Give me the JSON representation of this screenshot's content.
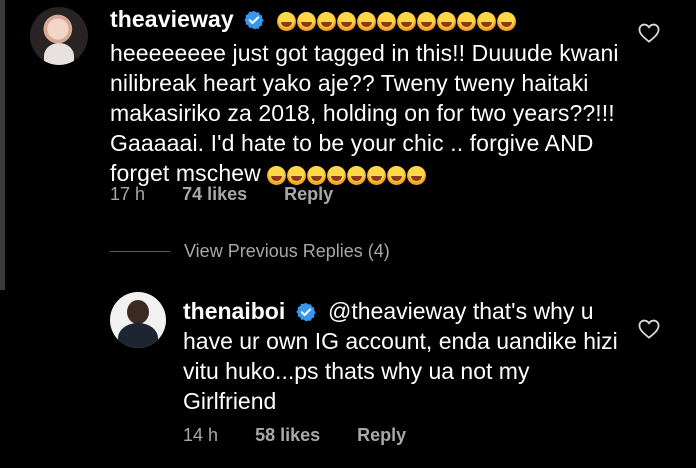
{
  "main_comment": {
    "username": "theavieway",
    "emoji_count_inline": 12,
    "text": "heeeeeeee just got tagged in this!! Duuude kwani nilibreak heart yako aje?? Tweny tweny haitaki makasiriko za 2018, holding on for two years??!!! Gaaaaai. I'd hate to be your chic .. forgive AND forget mschew",
    "trailing_emoji_count": 8,
    "time": "17 h",
    "likes": "74 likes",
    "reply": "Reply"
  },
  "view_previous": "View Previous Replies (4)",
  "reply_comment": {
    "username": "thenaiboi",
    "text": "@theavieway that's why u have ur own IG account, enda uandike hizi vitu huko...ps thats why ua not my Girlfriend",
    "time": "14 h",
    "likes": "58 likes",
    "reply": "Reply"
  },
  "icons": {
    "verified": "verified-badge-icon",
    "heart": "heart-outline-icon",
    "emoji": "rolling-on-floor-laughing-emoji"
  },
  "colors": {
    "background": "#000000",
    "text": "#ffffff",
    "meta": "#a8a8a8",
    "verified": "#3897f0"
  }
}
